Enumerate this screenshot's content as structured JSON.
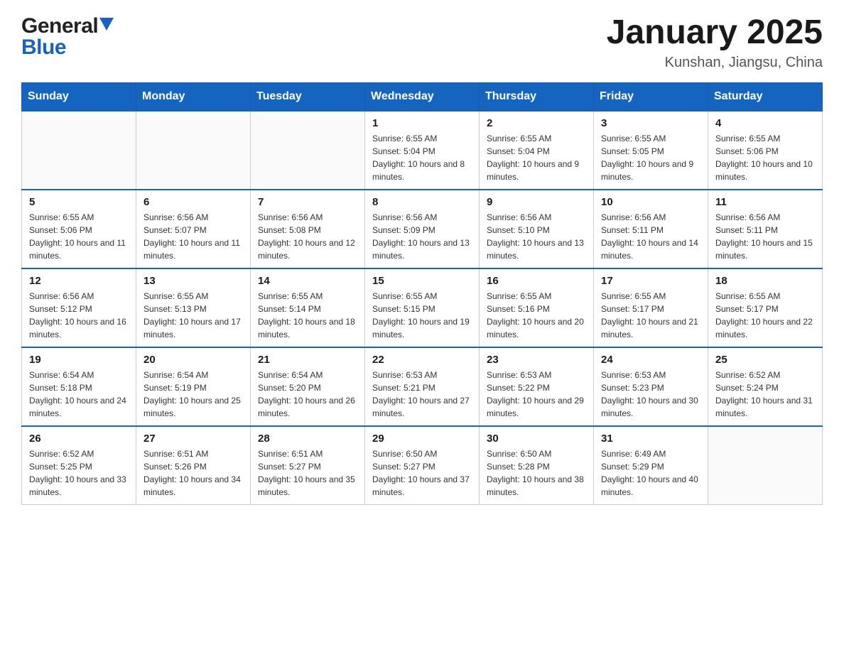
{
  "header": {
    "logo": {
      "general_text": "General",
      "blue_text": "Blue"
    },
    "title": "January 2025",
    "location": "Kunshan, Jiangsu, China"
  },
  "calendar": {
    "days_of_week": [
      "Sunday",
      "Monday",
      "Tuesday",
      "Wednesday",
      "Thursday",
      "Friday",
      "Saturday"
    ],
    "weeks": [
      [
        {
          "day": "",
          "info": ""
        },
        {
          "day": "",
          "info": ""
        },
        {
          "day": "",
          "info": ""
        },
        {
          "day": "1",
          "info": "Sunrise: 6:55 AM\nSunset: 5:04 PM\nDaylight: 10 hours and 8 minutes."
        },
        {
          "day": "2",
          "info": "Sunrise: 6:55 AM\nSunset: 5:04 PM\nDaylight: 10 hours and 9 minutes."
        },
        {
          "day": "3",
          "info": "Sunrise: 6:55 AM\nSunset: 5:05 PM\nDaylight: 10 hours and 9 minutes."
        },
        {
          "day": "4",
          "info": "Sunrise: 6:55 AM\nSunset: 5:06 PM\nDaylight: 10 hours and 10 minutes."
        }
      ],
      [
        {
          "day": "5",
          "info": "Sunrise: 6:55 AM\nSunset: 5:06 PM\nDaylight: 10 hours and 11 minutes."
        },
        {
          "day": "6",
          "info": "Sunrise: 6:56 AM\nSunset: 5:07 PM\nDaylight: 10 hours and 11 minutes."
        },
        {
          "day": "7",
          "info": "Sunrise: 6:56 AM\nSunset: 5:08 PM\nDaylight: 10 hours and 12 minutes."
        },
        {
          "day": "8",
          "info": "Sunrise: 6:56 AM\nSunset: 5:09 PM\nDaylight: 10 hours and 13 minutes."
        },
        {
          "day": "9",
          "info": "Sunrise: 6:56 AM\nSunset: 5:10 PM\nDaylight: 10 hours and 13 minutes."
        },
        {
          "day": "10",
          "info": "Sunrise: 6:56 AM\nSunset: 5:11 PM\nDaylight: 10 hours and 14 minutes."
        },
        {
          "day": "11",
          "info": "Sunrise: 6:56 AM\nSunset: 5:11 PM\nDaylight: 10 hours and 15 minutes."
        }
      ],
      [
        {
          "day": "12",
          "info": "Sunrise: 6:56 AM\nSunset: 5:12 PM\nDaylight: 10 hours and 16 minutes."
        },
        {
          "day": "13",
          "info": "Sunrise: 6:55 AM\nSunset: 5:13 PM\nDaylight: 10 hours and 17 minutes."
        },
        {
          "day": "14",
          "info": "Sunrise: 6:55 AM\nSunset: 5:14 PM\nDaylight: 10 hours and 18 minutes."
        },
        {
          "day": "15",
          "info": "Sunrise: 6:55 AM\nSunset: 5:15 PM\nDaylight: 10 hours and 19 minutes."
        },
        {
          "day": "16",
          "info": "Sunrise: 6:55 AM\nSunset: 5:16 PM\nDaylight: 10 hours and 20 minutes."
        },
        {
          "day": "17",
          "info": "Sunrise: 6:55 AM\nSunset: 5:17 PM\nDaylight: 10 hours and 21 minutes."
        },
        {
          "day": "18",
          "info": "Sunrise: 6:55 AM\nSunset: 5:17 PM\nDaylight: 10 hours and 22 minutes."
        }
      ],
      [
        {
          "day": "19",
          "info": "Sunrise: 6:54 AM\nSunset: 5:18 PM\nDaylight: 10 hours and 24 minutes."
        },
        {
          "day": "20",
          "info": "Sunrise: 6:54 AM\nSunset: 5:19 PM\nDaylight: 10 hours and 25 minutes."
        },
        {
          "day": "21",
          "info": "Sunrise: 6:54 AM\nSunset: 5:20 PM\nDaylight: 10 hours and 26 minutes."
        },
        {
          "day": "22",
          "info": "Sunrise: 6:53 AM\nSunset: 5:21 PM\nDaylight: 10 hours and 27 minutes."
        },
        {
          "day": "23",
          "info": "Sunrise: 6:53 AM\nSunset: 5:22 PM\nDaylight: 10 hours and 29 minutes."
        },
        {
          "day": "24",
          "info": "Sunrise: 6:53 AM\nSunset: 5:23 PM\nDaylight: 10 hours and 30 minutes."
        },
        {
          "day": "25",
          "info": "Sunrise: 6:52 AM\nSunset: 5:24 PM\nDaylight: 10 hours and 31 minutes."
        }
      ],
      [
        {
          "day": "26",
          "info": "Sunrise: 6:52 AM\nSunset: 5:25 PM\nDaylight: 10 hours and 33 minutes."
        },
        {
          "day": "27",
          "info": "Sunrise: 6:51 AM\nSunset: 5:26 PM\nDaylight: 10 hours and 34 minutes."
        },
        {
          "day": "28",
          "info": "Sunrise: 6:51 AM\nSunset: 5:27 PM\nDaylight: 10 hours and 35 minutes."
        },
        {
          "day": "29",
          "info": "Sunrise: 6:50 AM\nSunset: 5:27 PM\nDaylight: 10 hours and 37 minutes."
        },
        {
          "day": "30",
          "info": "Sunrise: 6:50 AM\nSunset: 5:28 PM\nDaylight: 10 hours and 38 minutes."
        },
        {
          "day": "31",
          "info": "Sunrise: 6:49 AM\nSunset: 5:29 PM\nDaylight: 10 hours and 40 minutes."
        },
        {
          "day": "",
          "info": ""
        }
      ]
    ]
  }
}
